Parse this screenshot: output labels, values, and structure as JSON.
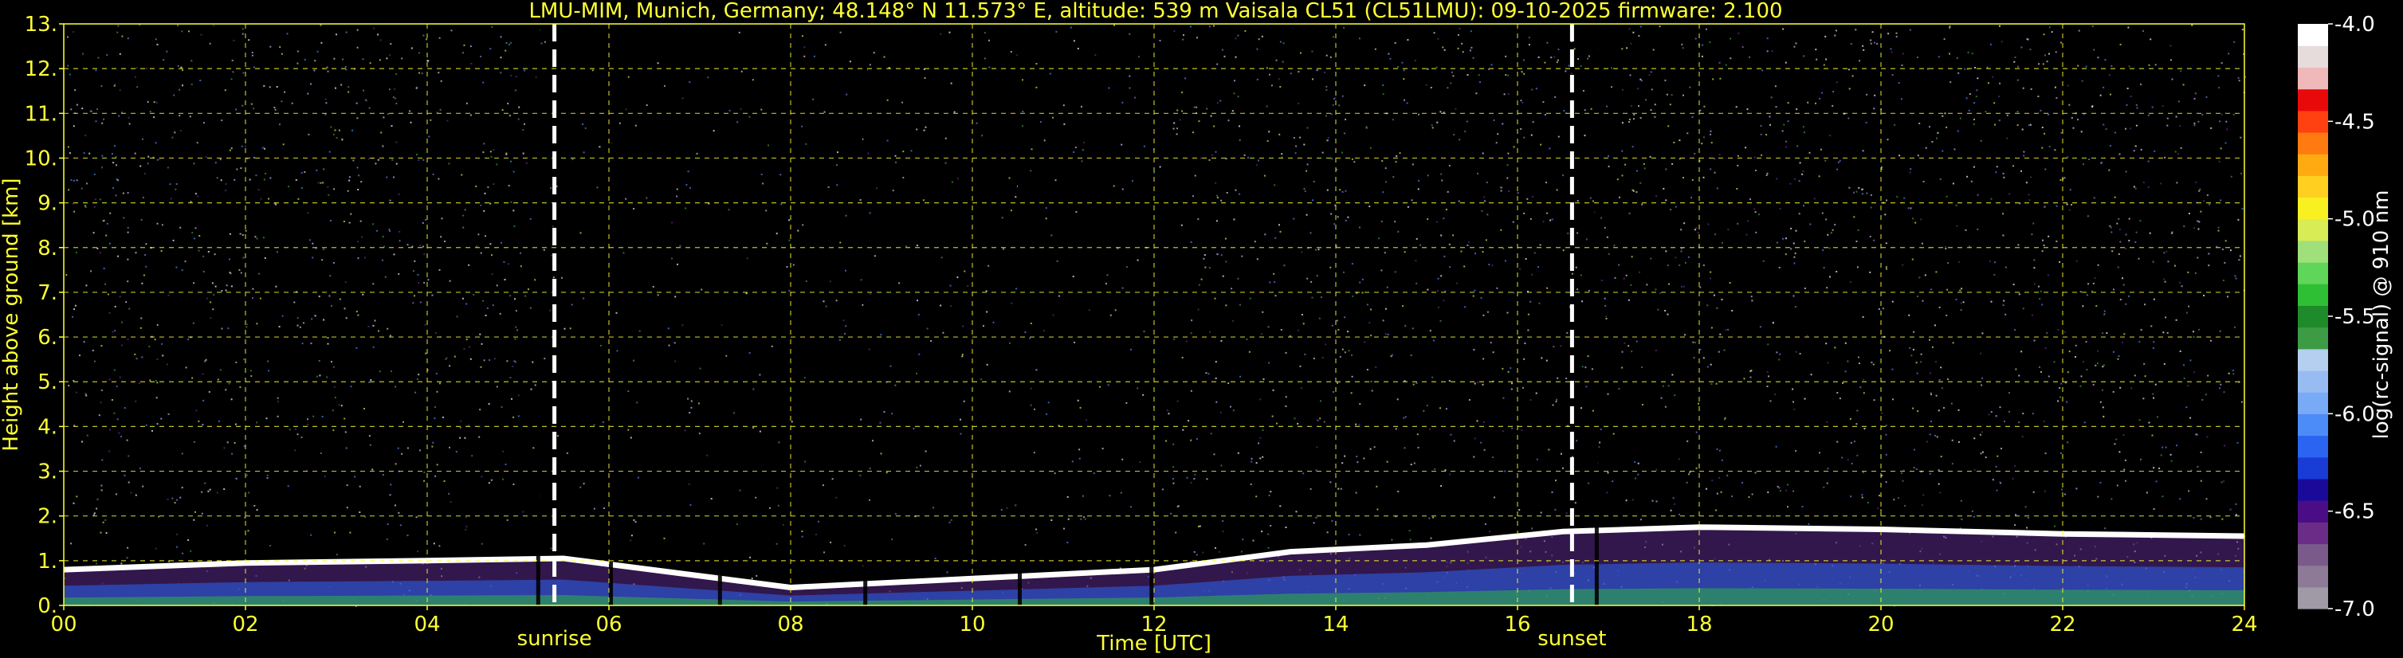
{
  "chart_data": {
    "type": "heatmap",
    "title": "LMU-MIM, Munich, Germany; 48.148° N 11.573° E, altitude: 539 m    Vaisala CL51 (CL51LMU): 09-10-2025    firmware: 2.100",
    "xlabel": "Time [UTC]",
    "ylabel": "Height above ground [km]",
    "xlim": [
      0,
      24
    ],
    "ylim": [
      0,
      13
    ],
    "x_ticks": [
      "00",
      "02",
      "04",
      "06",
      "08",
      "10",
      "12",
      "14",
      "16",
      "18",
      "20",
      "22",
      "24"
    ],
    "y_ticks": [
      "0.",
      "1.",
      "2.",
      "3.",
      "4.",
      "5.",
      "6.",
      "7.",
      "8.",
      "9.",
      "10.",
      "11.",
      "12.",
      "13."
    ],
    "grid": true,
    "colorbar": {
      "label": "log(rc-signal) @ 910 nm",
      "range": [
        -7.0,
        -4.0
      ],
      "ticks": [
        "-4.0",
        "-4.5",
        "-5.0",
        "-5.5",
        "-6.0",
        "-6.5",
        "-7.0"
      ],
      "colors": [
        "#a09aa6",
        "#8d7a96",
        "#7a5a8a",
        "#6a2c86",
        "#4b0d86",
        "#1a0a9a",
        "#1a3cd6",
        "#2a64f0",
        "#4c8cf8",
        "#78aaf6",
        "#98bcf2",
        "#b4cff0",
        "#3d9b45",
        "#1f8a2a",
        "#2fbf35",
        "#5fd55a",
        "#9fe07a",
        "#d8ec55",
        "#f8f020",
        "#ffd020",
        "#ffaa10",
        "#ff7a10",
        "#ff4010",
        "#e80a0a",
        "#f0b8b8",
        "#e6dcdc",
        "#ffffff"
      ]
    },
    "markers": [
      {
        "label": "sunrise",
        "x": 5.4
      },
      {
        "label": "sunset",
        "x": 16.6
      }
    ],
    "features": {
      "boundary_layer_top_km": [
        {
          "x": 0.0,
          "y": 0.8
        },
        {
          "x": 2.0,
          "y": 0.95
        },
        {
          "x": 4.0,
          "y": 1.0
        },
        {
          "x": 5.5,
          "y": 1.05
        },
        {
          "x": 8.0,
          "y": 0.4
        },
        {
          "x": 10.0,
          "y": 0.6
        },
        {
          "x": 12.0,
          "y": 0.8
        },
        {
          "x": 13.5,
          "y": 1.2
        },
        {
          "x": 15.0,
          "y": 1.35
        },
        {
          "x": 16.5,
          "y": 1.65
        },
        {
          "x": 18.0,
          "y": 1.75
        },
        {
          "x": 20.0,
          "y": 1.7
        },
        {
          "x": 22.0,
          "y": 1.6
        },
        {
          "x": 24.0,
          "y": 1.55
        }
      ],
      "signal_gaps_utc": [
        5.2,
        6.0,
        7.2,
        8.8,
        10.5,
        11.95,
        16.85
      ]
    }
  }
}
